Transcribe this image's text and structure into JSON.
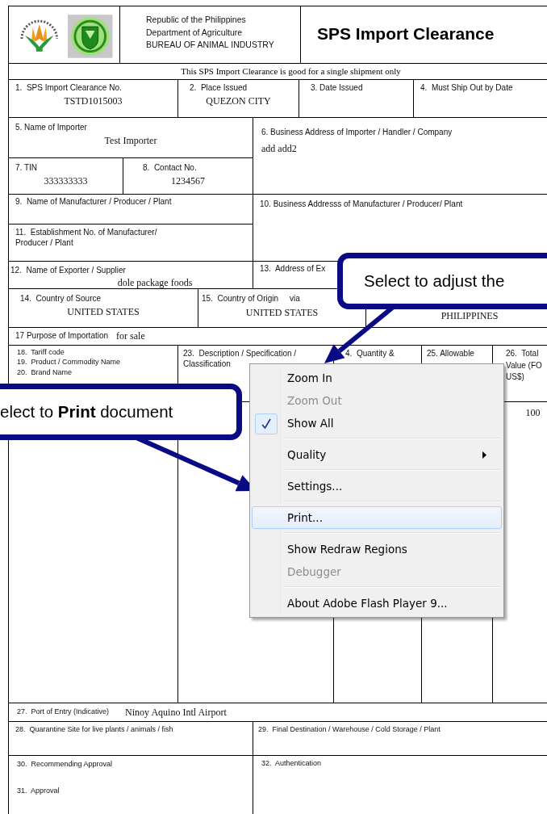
{
  "header": {
    "agency_lines": [
      "Republic of the Philippines",
      "Department of Agriculture",
      "BUREAU OF ANIMAL INDUSTRY"
    ],
    "title": "SPS Import Clearance"
  },
  "note": "This SPS Import Clearance is good for a single shipment only",
  "fields": [
    {
      "label": "1.  SPS Import Clearance No.",
      "value": "TSTD1015003"
    },
    {
      "label": "2.  Place Issued",
      "value": "QUEZON CITY"
    },
    {
      "label": "3. Date Issued"
    },
    {
      "label": "4.  Must Ship Out by Date"
    },
    {
      "label": "5. Name of Importer",
      "value": "Test Importer"
    },
    {
      "label": "6. Business Address of Importer / Handler / Company",
      "value": "add add2"
    },
    {
      "label": "7. TIN",
      "value": "333333333"
    },
    {
      "label": "8.  Contact No.",
      "value": "1234567"
    },
    {
      "label": "9.  Name of Manufacturer / Producer / Plant"
    },
    {
      "label": "10. Business Addresss of Manufacturer / Producer/ Plant"
    },
    {
      "label": "11.  Establishment No. of Manufacturer/ Producer / Plant"
    },
    {
      "label": "12.  Name of Exporter / Supplier",
      "value": "dole package foods"
    },
    {
      "label": "13.  Address of Ex"
    },
    {
      "label": "14.  Country of Source",
      "value": "UNITED STATES"
    },
    {
      "label": "15.  Country of Origin",
      "extra": "via",
      "value": "UNITED STATES"
    },
    {
      "value": "PHILIPPINES"
    },
    {
      "label": "17 Purpose of Importation",
      "value": "for sale"
    },
    {
      "label": "27.  Port of Entry (Indicative)",
      "value": "Ninoy Aquino Intl Airport"
    },
    {
      "label": "28.  Quarantine Site for live plants / animals / fish"
    },
    {
      "label": "29.  Final Destination / Warehouse / Cold Storage / Plant"
    },
    {
      "label": "30.  Recommending Approval"
    },
    {
      "label": "31.  Approval"
    },
    {
      "label": "32.  Authentication"
    }
  ],
  "items_table": {
    "columns": [
      {
        "lines": [
          "18.  Tariff code",
          "19.  Product / Commodity Name",
          "20.  Brand Name"
        ]
      },
      {
        "lines": [
          "23.  Description / Specification / Classification"
        ]
      },
      {
        "lines": [
          "4.  Quantity &"
        ]
      },
      {
        "lines": [
          "25. Allowable"
        ]
      },
      {
        "lines": [
          "26.  Total",
          "Value (FO",
          "US$)"
        ],
        "value": "100"
      }
    ]
  },
  "context_menu": [
    {
      "kind": "item",
      "label": "Zoom In",
      "disabled": false,
      "checked": false,
      "selected": false
    },
    {
      "kind": "item",
      "label": "Zoom Out",
      "disabled": true,
      "checked": false,
      "selected": false
    },
    {
      "kind": "item",
      "label": "Show All",
      "disabled": false,
      "checked": true,
      "selected": false
    },
    {
      "kind": "separator"
    },
    {
      "kind": "submenu",
      "label": "Quality",
      "disabled": false,
      "checked": false,
      "selected": false
    },
    {
      "kind": "separator"
    },
    {
      "kind": "item",
      "label": "Settings...",
      "disabled": false,
      "checked": false,
      "selected": false
    },
    {
      "kind": "separator"
    },
    {
      "kind": "item",
      "label": "Print...",
      "disabled": false,
      "checked": false,
      "selected": true
    },
    {
      "kind": "separator"
    },
    {
      "kind": "item",
      "label": "Show Redraw Regions",
      "disabled": false,
      "checked": false,
      "selected": false
    },
    {
      "kind": "item",
      "label": "Debugger",
      "disabled": true,
      "checked": false,
      "selected": false
    },
    {
      "kind": "separator"
    },
    {
      "kind": "item",
      "label": "About Adobe Flash Player 9...",
      "disabled": false,
      "checked": false,
      "selected": false
    }
  ],
  "callouts": [
    {
      "text": "Select to adjust the"
    },
    {
      "text": "elect to **Print** document"
    }
  ]
}
